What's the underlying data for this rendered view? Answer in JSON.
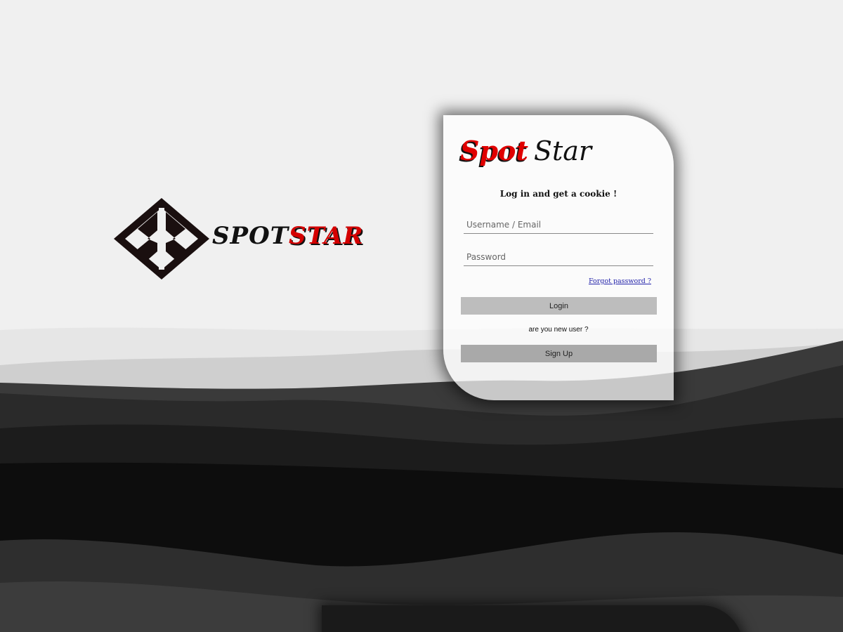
{
  "brand": {
    "word_part1": "SPOT",
    "word_part2": "STAR"
  },
  "card": {
    "logo_part1": "Spot",
    "logo_part2": "Star",
    "tagline": "Log in and get a cookie !",
    "username_placeholder": "Username / Email",
    "password_placeholder": "Password",
    "forgot_label": "Forgot password ?",
    "login_label": "Login",
    "new_user_text": "are you new user ?",
    "signup_label": "Sign Up"
  },
  "colors": {
    "accent_red": "#d40000",
    "background": "#f0f0f0",
    "button_gray": "#bdbdbd"
  }
}
